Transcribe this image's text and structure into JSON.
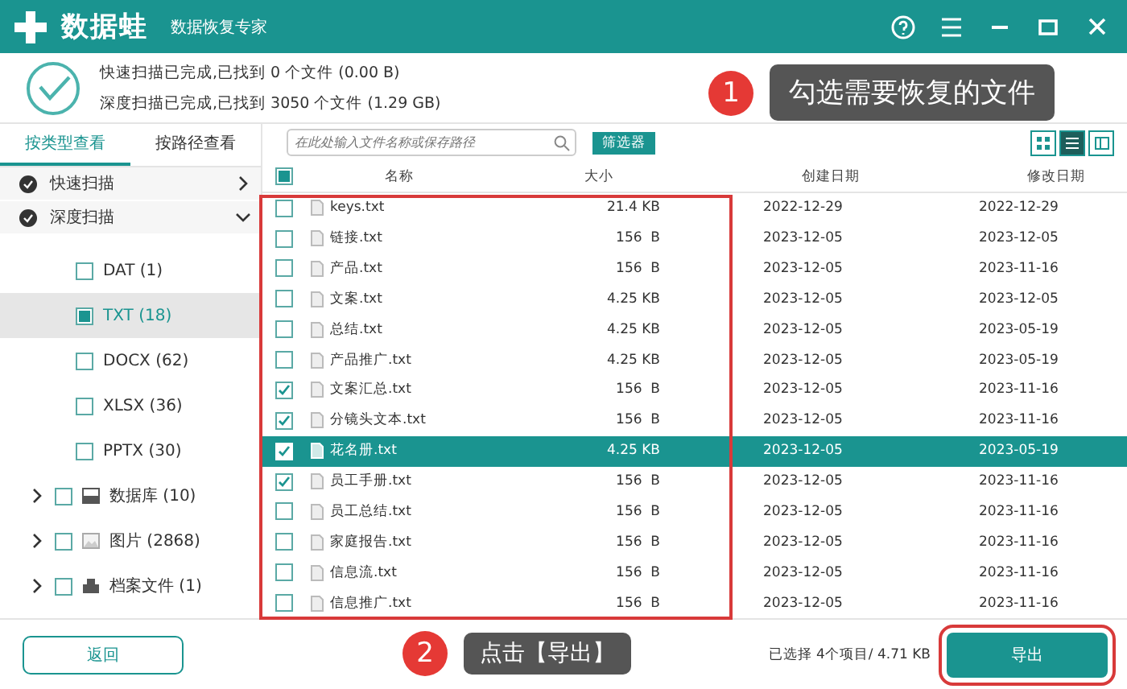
{
  "app": {
    "name": "数据蛙",
    "subtitle": "数据恢复专家"
  },
  "scan_summary": [
    "快速扫描已完成,已找到 0 个文件 (0.00  B)",
    "深度扫描已完成,已找到 3050 个文件 (1.29 GB)"
  ],
  "view_tabs": [
    {
      "label": "按类型查看",
      "selected": true
    },
    {
      "label": "按路径查看",
      "selected": false
    }
  ],
  "scan_groups": [
    {
      "label": "快速扫描",
      "expanded": false
    },
    {
      "label": "深度扫描",
      "expanded": true
    }
  ],
  "file_types": [
    {
      "label": "DAT (1)",
      "partially_checked": false,
      "selected": false
    },
    {
      "label": "TXT (18)",
      "partially_checked": true,
      "selected": true
    },
    {
      "label": "DOCX (62)",
      "partially_checked": false,
      "selected": false
    },
    {
      "label": "XLSX (36)",
      "partially_checked": false,
      "selected": false
    },
    {
      "label": "PPTX (30)",
      "partially_checked": false,
      "selected": false
    }
  ],
  "categories": [
    {
      "label": "数据库 (10)",
      "kind": "database",
      "checked": false
    },
    {
      "label": "图片 (2868)",
      "kind": "image",
      "checked": false
    },
    {
      "label": "档案文件 (1)",
      "kind": "archive",
      "checked": false
    }
  ],
  "search": {
    "placeholder": "在此处输入文件名称或保存路径"
  },
  "filter_button": "筛选器",
  "view_modes": [
    {
      "kind": "grid",
      "selected": false
    },
    {
      "kind": "list",
      "selected": true
    },
    {
      "kind": "columns",
      "selected": false
    }
  ],
  "table": {
    "columns": [
      "名称",
      "大小",
      "创建日期",
      "修改日期"
    ],
    "header_partially_checked": true,
    "rows": [
      {
        "name": "keys.txt",
        "size": "21.4 KB",
        "created": "2022-12-29",
        "modified": "2022-12-29",
        "checked": false,
        "selected": false
      },
      {
        "name": "链接.txt",
        "size": "156  B",
        "created": "2023-12-05",
        "modified": "2023-12-05",
        "checked": false,
        "selected": false
      },
      {
        "name": "产品.txt",
        "size": "156  B",
        "created": "2023-12-05",
        "modified": "2023-11-16",
        "checked": false,
        "selected": false
      },
      {
        "name": "文案.txt",
        "size": "4.25 KB",
        "created": "2023-12-05",
        "modified": "2023-12-05",
        "checked": false,
        "selected": false
      },
      {
        "name": "总结.txt",
        "size": "4.25 KB",
        "created": "2023-12-05",
        "modified": "2023-05-19",
        "checked": false,
        "selected": false
      },
      {
        "name": "产品推广.txt",
        "size": "4.25 KB",
        "created": "2023-12-05",
        "modified": "2023-05-19",
        "checked": false,
        "selected": false
      },
      {
        "name": "文案汇总.txt",
        "size": "156  B",
        "created": "2023-12-05",
        "modified": "2023-11-16",
        "checked": true,
        "selected": false
      },
      {
        "name": "分镜头文本.txt",
        "size": "156  B",
        "created": "2023-12-05",
        "modified": "2023-11-16",
        "checked": true,
        "selected": false
      },
      {
        "name": "花名册.txt",
        "size": "4.25 KB",
        "created": "2023-12-05",
        "modified": "2023-05-19",
        "checked": true,
        "selected": true
      },
      {
        "name": "员工手册.txt",
        "size": "156  B",
        "created": "2023-12-05",
        "modified": "2023-11-16",
        "checked": true,
        "selected": false
      },
      {
        "name": "员工总结.txt",
        "size": "156  B",
        "created": "2023-12-05",
        "modified": "2023-11-16",
        "checked": false,
        "selected": false
      },
      {
        "name": "家庭报告.txt",
        "size": "156  B",
        "created": "2023-12-05",
        "modified": "2023-11-16",
        "checked": false,
        "selected": false
      },
      {
        "name": "信息流.txt",
        "size": "156  B",
        "created": "2023-12-05",
        "modified": "2023-11-16",
        "checked": false,
        "selected": false
      },
      {
        "name": "信息推广.txt",
        "size": "156  B",
        "created": "2023-12-05",
        "modified": "2023-11-16",
        "checked": false,
        "selected": false
      }
    ]
  },
  "selection_summary": "已选择 4个项目/ 4.71 KB",
  "back_button": "返回",
  "export_button": "导出",
  "callouts": [
    {
      "number": "1",
      "text": "勾选需要恢复的文件"
    },
    {
      "number": "2",
      "text": "点击【导出】"
    }
  ]
}
